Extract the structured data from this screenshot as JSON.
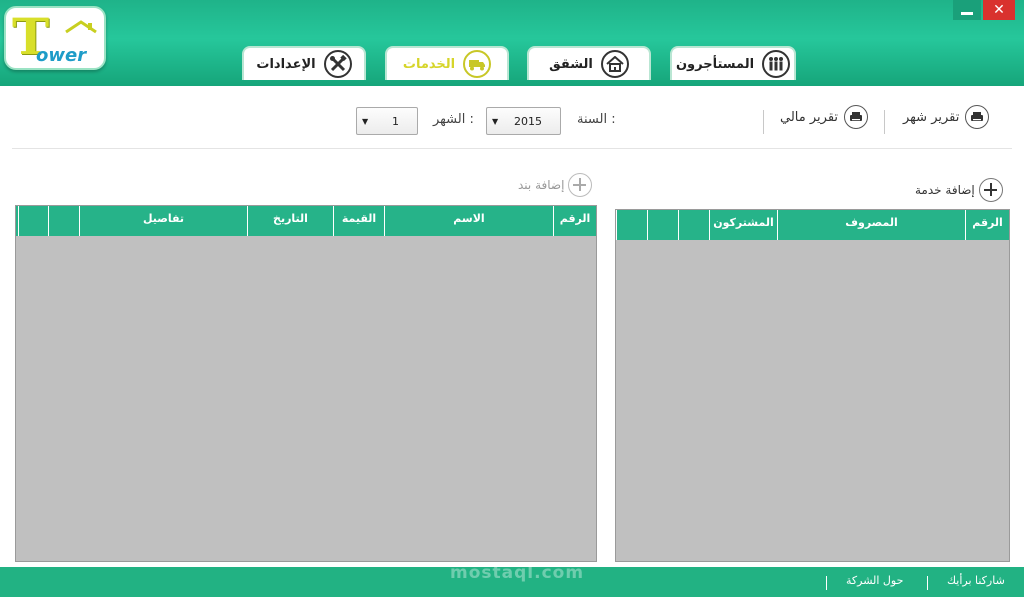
{
  "app": {
    "logo_text": "ower",
    "logo_initial": "T"
  },
  "window": {
    "minimize_icon": "minimize-icon",
    "close_label": "✕"
  },
  "tabs": [
    {
      "label": "المستأجرون",
      "icon": "people-icon"
    },
    {
      "label": "الشقق",
      "icon": "house-icon"
    },
    {
      "label": "الخدمات",
      "icon": "truck-icon",
      "active": true
    },
    {
      "label": "الإعدادات",
      "icon": "tools-icon"
    }
  ],
  "toolbar": {
    "monthly_report": "تقرير شهر",
    "financial_report": "تقرير مالي",
    "year_label": "السنة :",
    "year_value": "2015",
    "month_label": "الشهر :",
    "month_value": "1"
  },
  "services_panel": {
    "add_label": "إضافة خدمة",
    "columns": [
      "الرقم",
      "المصروف",
      "المشتركون",
      "",
      "",
      ""
    ]
  },
  "items_panel": {
    "add_label": "إضافة بند",
    "columns": [
      "الرقم",
      "الاسم",
      "القيمة",
      "التاريخ",
      "تفاصيل",
      "",
      ""
    ]
  },
  "footer": {
    "feedback": "شاركنا برأيك",
    "about": "حول الشركة"
  },
  "watermark": "mostaql.com",
  "colors": {
    "accent": "#26b389",
    "active_tab": "#d6d52a",
    "close": "#d9322e",
    "grid_body": "#c0c0c0"
  }
}
